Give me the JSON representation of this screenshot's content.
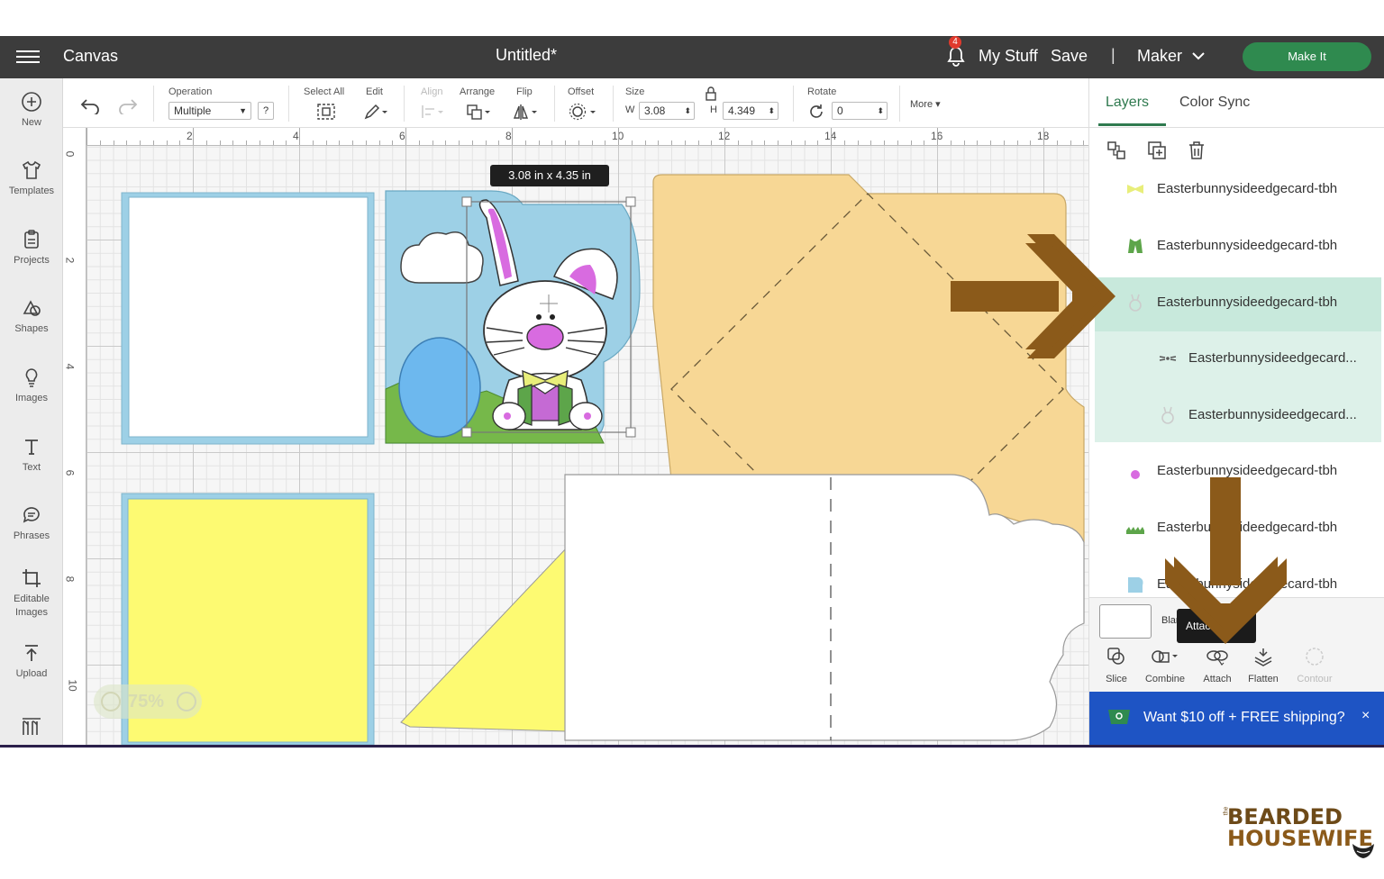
{
  "topbar": {
    "app_title": "Canvas",
    "doc_title": "Untitled*",
    "notification_count": "4",
    "my_stuff": "My Stuff",
    "save": "Save",
    "separator": "|",
    "machine": "Maker",
    "make_it": "Make It"
  },
  "left_tools": [
    {
      "label": "New",
      "icon": "plus-circle-icon"
    },
    {
      "label": "Templates",
      "icon": "shirt-icon"
    },
    {
      "label": "Projects",
      "icon": "clipboard-icon"
    },
    {
      "label": "Shapes",
      "icon": "shapes-icon"
    },
    {
      "label": "Images",
      "icon": "lightbulb-icon"
    },
    {
      "label": "Text",
      "icon": "text-icon"
    },
    {
      "label": "Phrases",
      "icon": "speech-bubble-icon"
    },
    {
      "label": "Editable\nImages",
      "icon": "crop-icon"
    },
    {
      "label": "Upload",
      "icon": "upload-icon"
    },
    {
      "label": "",
      "icon": "monogram-icon"
    }
  ],
  "toolbar": {
    "operation_label": "Operation",
    "operation_value": "Multiple",
    "help": "?",
    "select_all": "Select All",
    "edit": "Edit",
    "align": "Align",
    "arrange": "Arrange",
    "flip": "Flip",
    "offset": "Offset",
    "size": "Size",
    "w_label": "W",
    "w_value": "3.08",
    "h_label": "H",
    "h_value": "4.349",
    "rotate": "Rotate",
    "rotate_value": "0",
    "more": "More"
  },
  "canvas": {
    "ruler_top": [
      "2",
      "4",
      "6",
      "8",
      "10",
      "12",
      "14",
      "16",
      "18"
    ],
    "ruler_left": [
      "0",
      "2",
      "4",
      "6",
      "8",
      "10"
    ],
    "dimension_tooltip": "3.08  in x 4.35  in",
    "zoom": "75%"
  },
  "panel": {
    "tabs": [
      "Layers",
      "Color Sync"
    ],
    "layers": [
      {
        "name": "Easterbunnysideedgecard-tbh",
        "icon": "bowtie-icon",
        "color": "#e8ee7a"
      },
      {
        "name": "Easterbunnysideedgecard-tbh",
        "icon": "jacket-icon",
        "color": "#5da54a"
      },
      {
        "name": "Easterbunnysideedgecard-tbh",
        "icon": "bunny-icon",
        "color": "#cccccc"
      },
      {
        "name": "Easterbunnysideedgecard...",
        "icon": "whiskers-icon",
        "color": "#555555"
      },
      {
        "name": "Easterbunnysideedgecard...",
        "icon": "bunny-outline-icon",
        "color": "#cccccc"
      },
      {
        "name": "Easterbunnysideedgecard-tbh",
        "icon": "bunny-pink-icon",
        "color": "#d86be0"
      },
      {
        "name": "Easterbunnysideedgecard-tbh",
        "icon": "grass-icon",
        "color": "#5da54a"
      },
      {
        "name": "Easterbunnysideedgecard-tbh",
        "icon": "card-blue-icon",
        "color": "#9dd0e6"
      }
    ],
    "blend_text": "Blank",
    "attach_tooltip": "Attach",
    "bottom_tools": [
      {
        "label": "Slice",
        "icon": "slice-icon"
      },
      {
        "label": "Combine",
        "icon": "combine-icon"
      },
      {
        "label": "Attach",
        "icon": "attach-icon"
      },
      {
        "label": "Flatten",
        "icon": "flatten-icon"
      },
      {
        "label": "Contour",
        "icon": "contour-icon"
      }
    ],
    "promo": "Want $10 off + FREE shipping?",
    "promo_close": "×"
  },
  "logo": {
    "the": "the",
    "line1": "BEARDED",
    "line2": "HOUSEWIFE"
  },
  "colors": {
    "topbar": "#3c3c3c",
    "accent_green": "#2f7a4f",
    "card_blue": "#9dd0e6",
    "card_yellow": "#fdfa72",
    "envelope": "#f7d795",
    "arrow_brown": "#8b5a1a",
    "promo_blue": "#1e54c4"
  }
}
